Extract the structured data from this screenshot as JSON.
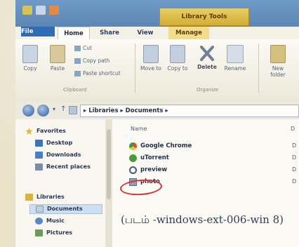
{
  "title_bar": {
    "contextual_tab": "Library Tools"
  },
  "ribbon_tabs": {
    "file": "File",
    "home": "Home",
    "share": "Share",
    "view": "View",
    "manage": "Manage"
  },
  "ribbon": {
    "copy": "Copy",
    "paste": "Paste",
    "cut": "Cut",
    "copy_path": "Copy path",
    "paste_shortcut": "Paste shortcut",
    "clipboard_group": "Clipboard",
    "move_to": "Move to",
    "copy_to": "Copy to",
    "delete": "Delete",
    "rename": "Rename",
    "organize_group": "Organize",
    "new_folder": "New folder"
  },
  "address_bar": {
    "path": "▸ Libraries ▸ Documents ▸"
  },
  "nav_pane": {
    "favorites": "Favorites",
    "desktop": "Desktop",
    "downloads": "Downloads",
    "recent_places": "Recent places",
    "libraries": "Libraries",
    "documents": "Documents",
    "music": "Music",
    "pictures": "Pictures"
  },
  "file_list": {
    "header_name": "Name",
    "header_date": "D",
    "items": [
      "Google Chrome",
      "uTorrent",
      "preview",
      "photo"
    ],
    "date_col": [
      "D",
      "D",
      "D",
      "D"
    ]
  },
  "caption": "(படம் -windows-ext-006-win 8)",
  "colors": {
    "highlight_circle": "#d9342b",
    "file_tab": "#2f6cb5",
    "contextual_tab": "#d3ac35"
  }
}
